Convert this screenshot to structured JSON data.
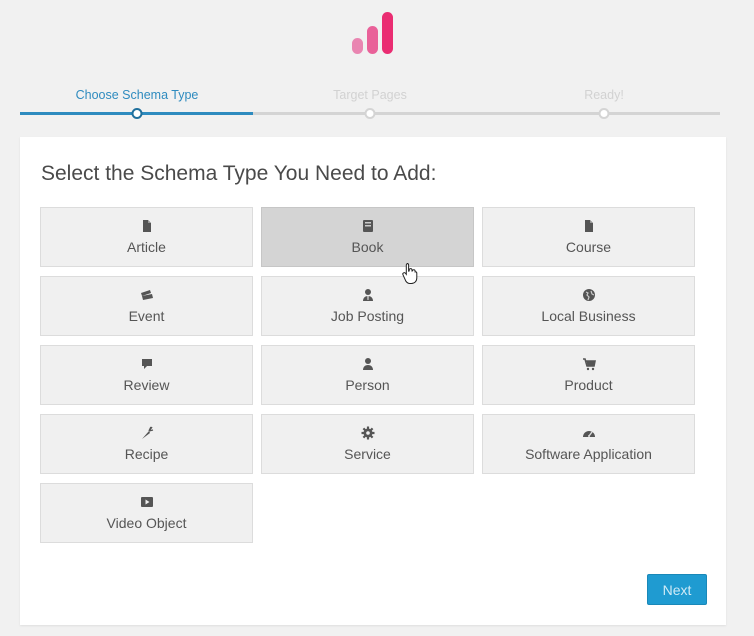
{
  "wizard": {
    "steps": [
      {
        "label": "Choose Schema Type",
        "state": "active"
      },
      {
        "label": "Target Pages",
        "state": "pending"
      },
      {
        "label": "Ready!",
        "state": "pending"
      }
    ]
  },
  "main": {
    "heading": "Select the Schema Type You Need to Add:",
    "schema_types": [
      {
        "label": "Article",
        "icon": "document-icon"
      },
      {
        "label": "Book",
        "icon": "book-icon"
      },
      {
        "label": "Course",
        "icon": "document-icon"
      },
      {
        "label": "Event",
        "icon": "tickets-icon"
      },
      {
        "label": "Job Posting",
        "icon": "user-tie-icon"
      },
      {
        "label": "Local Business",
        "icon": "globe-icon"
      },
      {
        "label": "Review",
        "icon": "comment-icon"
      },
      {
        "label": "Person",
        "icon": "person-icon"
      },
      {
        "label": "Product",
        "icon": "cart-icon"
      },
      {
        "label": "Recipe",
        "icon": "carrot-icon"
      },
      {
        "label": "Service",
        "icon": "gear-icon"
      },
      {
        "label": "Software Application",
        "icon": "gauge-icon"
      },
      {
        "label": "Video Object",
        "icon": "video-play-icon"
      }
    ],
    "hovered": "Book",
    "next_label": "Next"
  },
  "colors": {
    "accent": "#2e8bbf",
    "button": "#1f9bd1",
    "logo": [
      "#e985b1",
      "#e96199",
      "#ea2d72"
    ]
  }
}
